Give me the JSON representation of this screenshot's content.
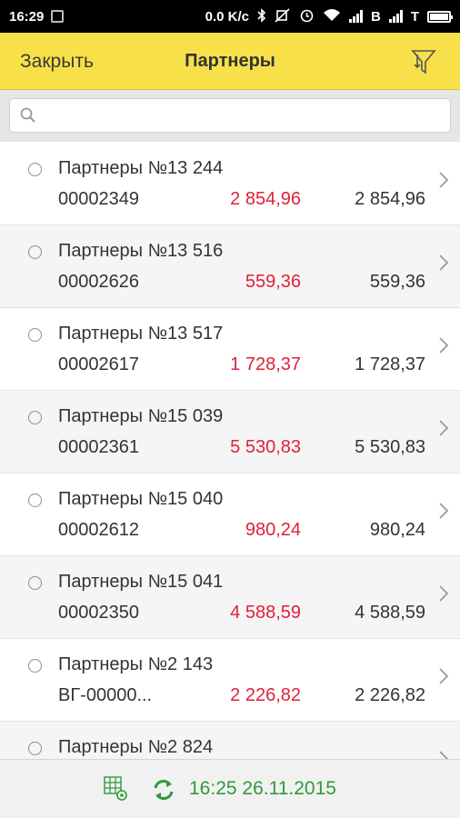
{
  "statusbar": {
    "time": "16:29",
    "speed": "0.0 K/c",
    "carrier1": "B",
    "carrier2": "T",
    "icons": [
      "image-icon",
      "bluetooth-icon",
      "mute-icon",
      "alarm-icon",
      "wifi-icon",
      "signal-icon",
      "signal-icon",
      "battery-icon"
    ]
  },
  "header": {
    "close_label": "Закрыть",
    "title": "Партнеры",
    "filter_icon": "filter-icon"
  },
  "search": {
    "placeholder": "",
    "value": ""
  },
  "colors": {
    "header_bg": "#f8e04a",
    "debt_red": "#e0203a",
    "sync_green": "#2f9a3c"
  },
  "rows": [
    {
      "name": "Партнеры №13 244",
      "code": "00002349",
      "debt": "2 854,96",
      "total": "2 854,96"
    },
    {
      "name": "Партнеры №13 516",
      "code": "00002626",
      "debt": "559,36",
      "total": "559,36"
    },
    {
      "name": "Партнеры №13 517",
      "code": "00002617",
      "debt": "1 728,37",
      "total": "1 728,37"
    },
    {
      "name": "Партнеры №15 039",
      "code": "00002361",
      "debt": "5 530,83",
      "total": "5 530,83"
    },
    {
      "name": "Партнеры №15 040",
      "code": "00002612",
      "debt": "980,24",
      "total": "980,24"
    },
    {
      "name": "Партнеры №15 041",
      "code": "00002350",
      "debt": "4 588,59",
      "total": "4 588,59"
    },
    {
      "name": "Партнеры №2 143",
      "code": "ВГ-00000...",
      "debt": "2 226,82",
      "total": "2 226,82"
    },
    {
      "name": "Партнеры №2 824",
      "code": "",
      "debt": "",
      "total": ""
    }
  ],
  "footer": {
    "datetime": "16:25 26.11.2015",
    "grid_icon": "table-settings-icon",
    "sync_icon": "sync-icon"
  }
}
